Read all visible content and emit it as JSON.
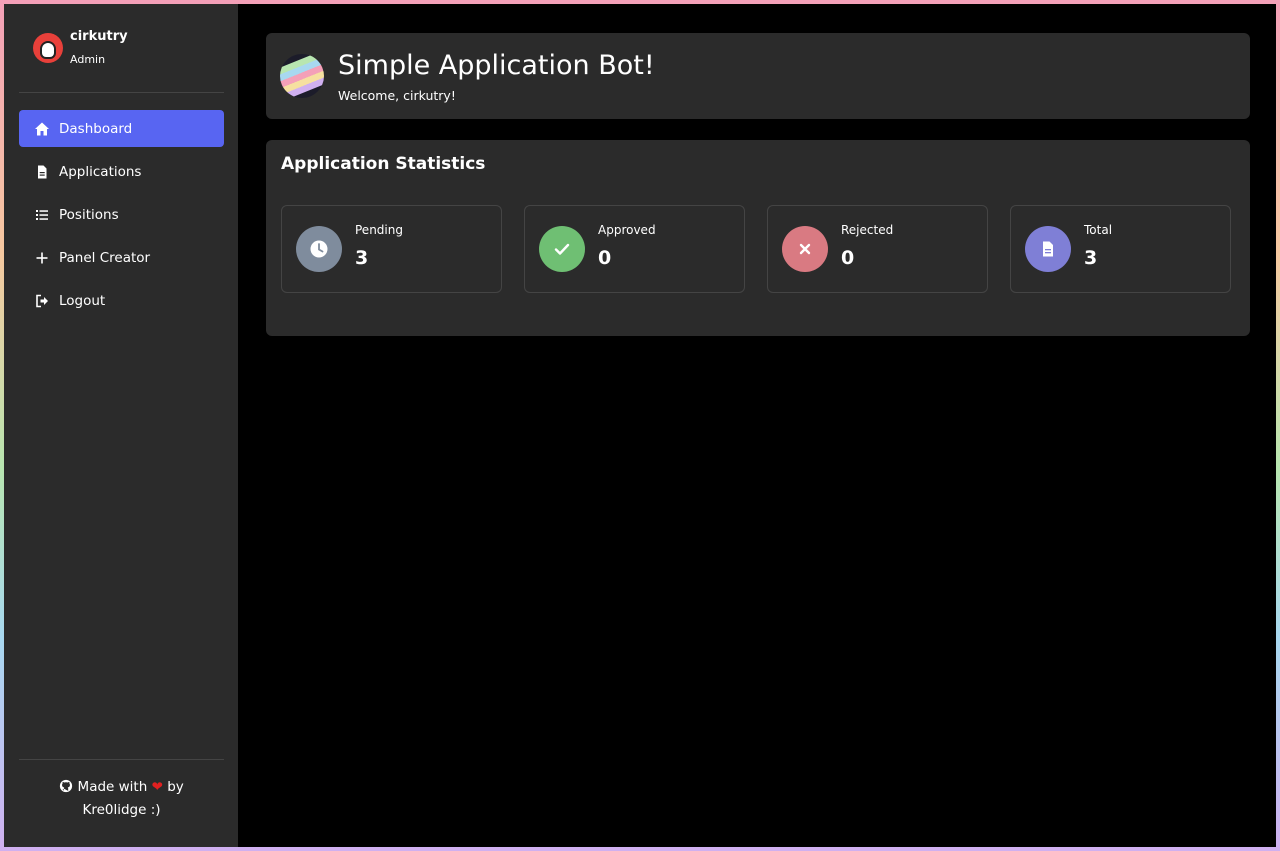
{
  "user": {
    "name": "cirkutry",
    "role": "Admin"
  },
  "nav": {
    "items": [
      {
        "label": "Dashboard",
        "icon": "home-icon",
        "active": true
      },
      {
        "label": "Applications",
        "icon": "file-icon"
      },
      {
        "label": "Positions",
        "icon": "list-icon"
      },
      {
        "label": "Panel Creator",
        "icon": "plus-icon"
      },
      {
        "label": "Logout",
        "icon": "logout-icon"
      }
    ]
  },
  "footer": {
    "made_with": "Made with",
    "by": "by",
    "author": "Kre0lidge :)",
    "icon": "github-icon",
    "heart_icon": "heart-icon"
  },
  "header": {
    "title": "Simple Application Bot!",
    "welcome": "Welcome, cirkutry!"
  },
  "stats": {
    "title": "Application Statistics",
    "items": [
      {
        "label": "Pending",
        "value": "3",
        "icon": "clock-icon",
        "color": "#7f8c9d"
      },
      {
        "label": "Approved",
        "value": "0",
        "icon": "check-icon",
        "color": "#6fbf73"
      },
      {
        "label": "Rejected",
        "value": "0",
        "icon": "x-icon",
        "color": "#d97a82"
      },
      {
        "label": "Total",
        "value": "3",
        "icon": "document-icon",
        "color": "#7f7fd6"
      }
    ]
  },
  "colors": {
    "accent": "#5865f2",
    "panel": "#2b2b2b",
    "background": "#000000"
  }
}
